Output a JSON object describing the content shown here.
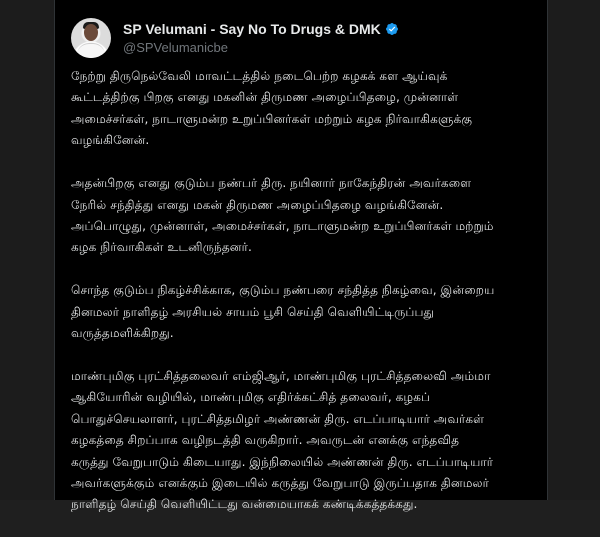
{
  "post": {
    "author": {
      "display_name": "SP Velumani - Say No To Drugs & DMK",
      "handle": "@SPVelumanicbe",
      "verified": true,
      "avatar_icon": "profile-avatar"
    },
    "paragraphs": [
      "நேற்று திருநெல்வேலி மாவட்டத்தில் நடைபெற்ற கழகக் கள ஆய்வுக்\nகூட்டத்திற்கு பிறகு எனது மகனின் திருமண அழைப்பிதழை, முன்னாள்\nஅமைச்சர்கள், நாடாளுமன்ற உறுப்பினர்கள் மற்றும் கழக நிர்வாகிகளுக்கு\nவழங்கினேன்.",
      "அதன்பிறகு எனது குடும்ப நண்பர் திரு. நயினார் நாகேந்திரன் அவர்களை\nநேரில் சந்தித்து எனது மகன் திருமண அழைப்பிதழை வழங்கினேன்.\nஅப்பொழுது, முன்னாள், அமைச்சர்கள், நாடாளுமன்ற உறுப்பினர்கள் மற்றும்\nகழக நிர்வாகிகள் உடனிருந்தனர்.",
      "சொந்த குடும்ப நிகழ்ச்சிக்காக, குடும்ப நண்பரை சந்தித்த நிகழ்வை, இன்றைய\nதினமலர் நாளிதழ் அரசியல் சாயம் பூசி செய்தி வெளியிட்டிருப்பது\nவருத்தமளிக்கிறது.",
      "மாண்புமிகு புரட்சித்தலைவர் எம்ஜிஆர், மாண்புமிகு புரட்சித்தலைவி அம்மா\nஆகியோரின் வழியில், மாண்புமிகு எதிர்க்கட்சித் தலைவர், கழகப்\nபொதுச்செயலாளர், புரட்சித்தமிழர் அண்ணன் திரு. எடப்பாடியார் அவர்கள்\nகழகத்தை சிறப்பாக வழிநடத்தி வருகிறார். அவருடன் எனக்கு எந்தவித\nகருத்து வேறுபாடும் கிடையாது. இந்நிலையில் அண்ணன் திரு. எடப்பாடியார்\nஅவர்களுக்கும் எனக்கும் இடையில் கருத்து வேறுபாடு இருப்பதாக தினமலர்\nநாளிதழ் செய்தி வெளியிட்டது வன்மையாகக் கண்டிக்கத்தக்கது."
    ]
  },
  "colors": {
    "background": "#000000",
    "text_primary": "#e7e9ea",
    "text_secondary": "#71767b",
    "verified_badge": "#1d9bf0"
  }
}
